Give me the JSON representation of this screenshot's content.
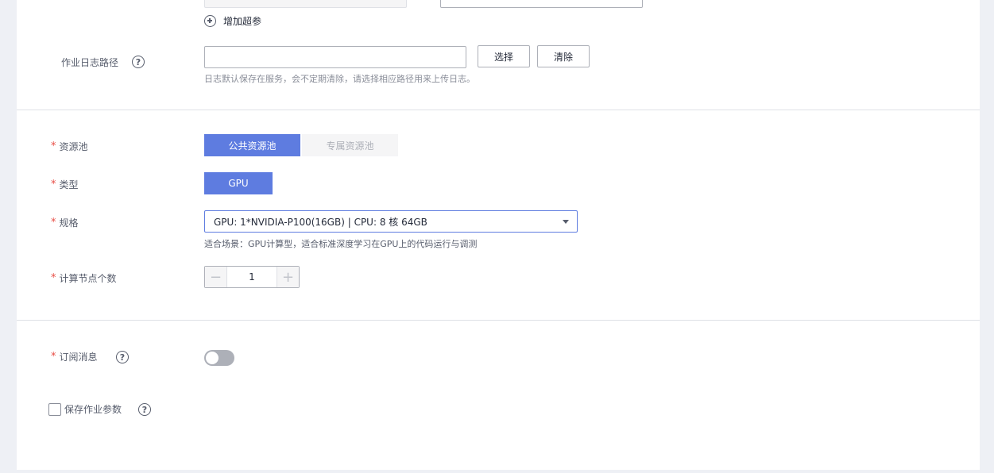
{
  "hyperparams": {
    "add_label": "增加超参"
  },
  "log_path": {
    "label": "作业日志路径",
    "value": "",
    "select_button": "选择",
    "clear_button": "清除",
    "hint": "日志默认保存在服务，会不定期清除，请选择相应路径用来上传日志。"
  },
  "resource_pool": {
    "label": "资源池",
    "options": [
      "公共资源池",
      "专属资源池"
    ],
    "selected": "公共资源池"
  },
  "type": {
    "label": "类型",
    "value": "GPU"
  },
  "spec": {
    "label": "规格",
    "value": "GPU: 1*NVIDIA-P100(16GB) | CPU: 8 核 64GB",
    "hint": "适合场景：GPU计算型，适合标准深度学习在GPU上的代码运行与调测"
  },
  "nodes": {
    "label": "计算节点个数",
    "value": "1",
    "minus": "−",
    "plus": "+"
  },
  "subscribe": {
    "label": "订阅消息",
    "enabled": false
  },
  "save_params": {
    "label": "保存作业参数",
    "checked": false
  },
  "required_mark": "*",
  "help_glyph": "?",
  "colors": {
    "accent": "#5e7ce0",
    "required": "#e84e46"
  }
}
